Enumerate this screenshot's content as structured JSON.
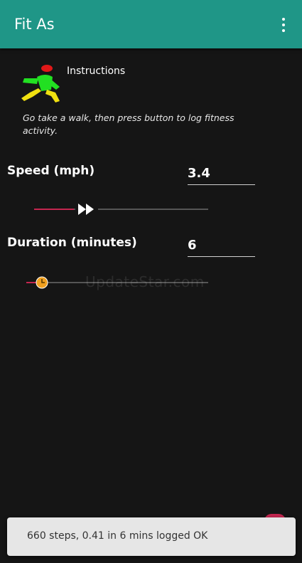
{
  "app_bar": {
    "title": "Fit As",
    "menu_icon": "more-vert-icon",
    "color": "#1f9687"
  },
  "instructions": {
    "icon": "walking-person-icon",
    "title": "Instructions",
    "body": "Go take a walk, then press button to log fitness activity."
  },
  "speed": {
    "label": "Speed (mph)",
    "value": "3.4",
    "slider_fraction": 0.27,
    "thumb_icon": "fast-forward-icon"
  },
  "duration": {
    "label": "Duration (minutes)",
    "value": "6",
    "slider_fraction": 0.08,
    "thumb_icon": "clock-icon"
  },
  "watermark": "UpdateStar.com",
  "toast": {
    "message": "660 steps, 0.41  in 6 mins logged OK"
  },
  "colors": {
    "accent": "#c4264f",
    "background": "#151515",
    "toast_bg": "#e6e6e6"
  }
}
